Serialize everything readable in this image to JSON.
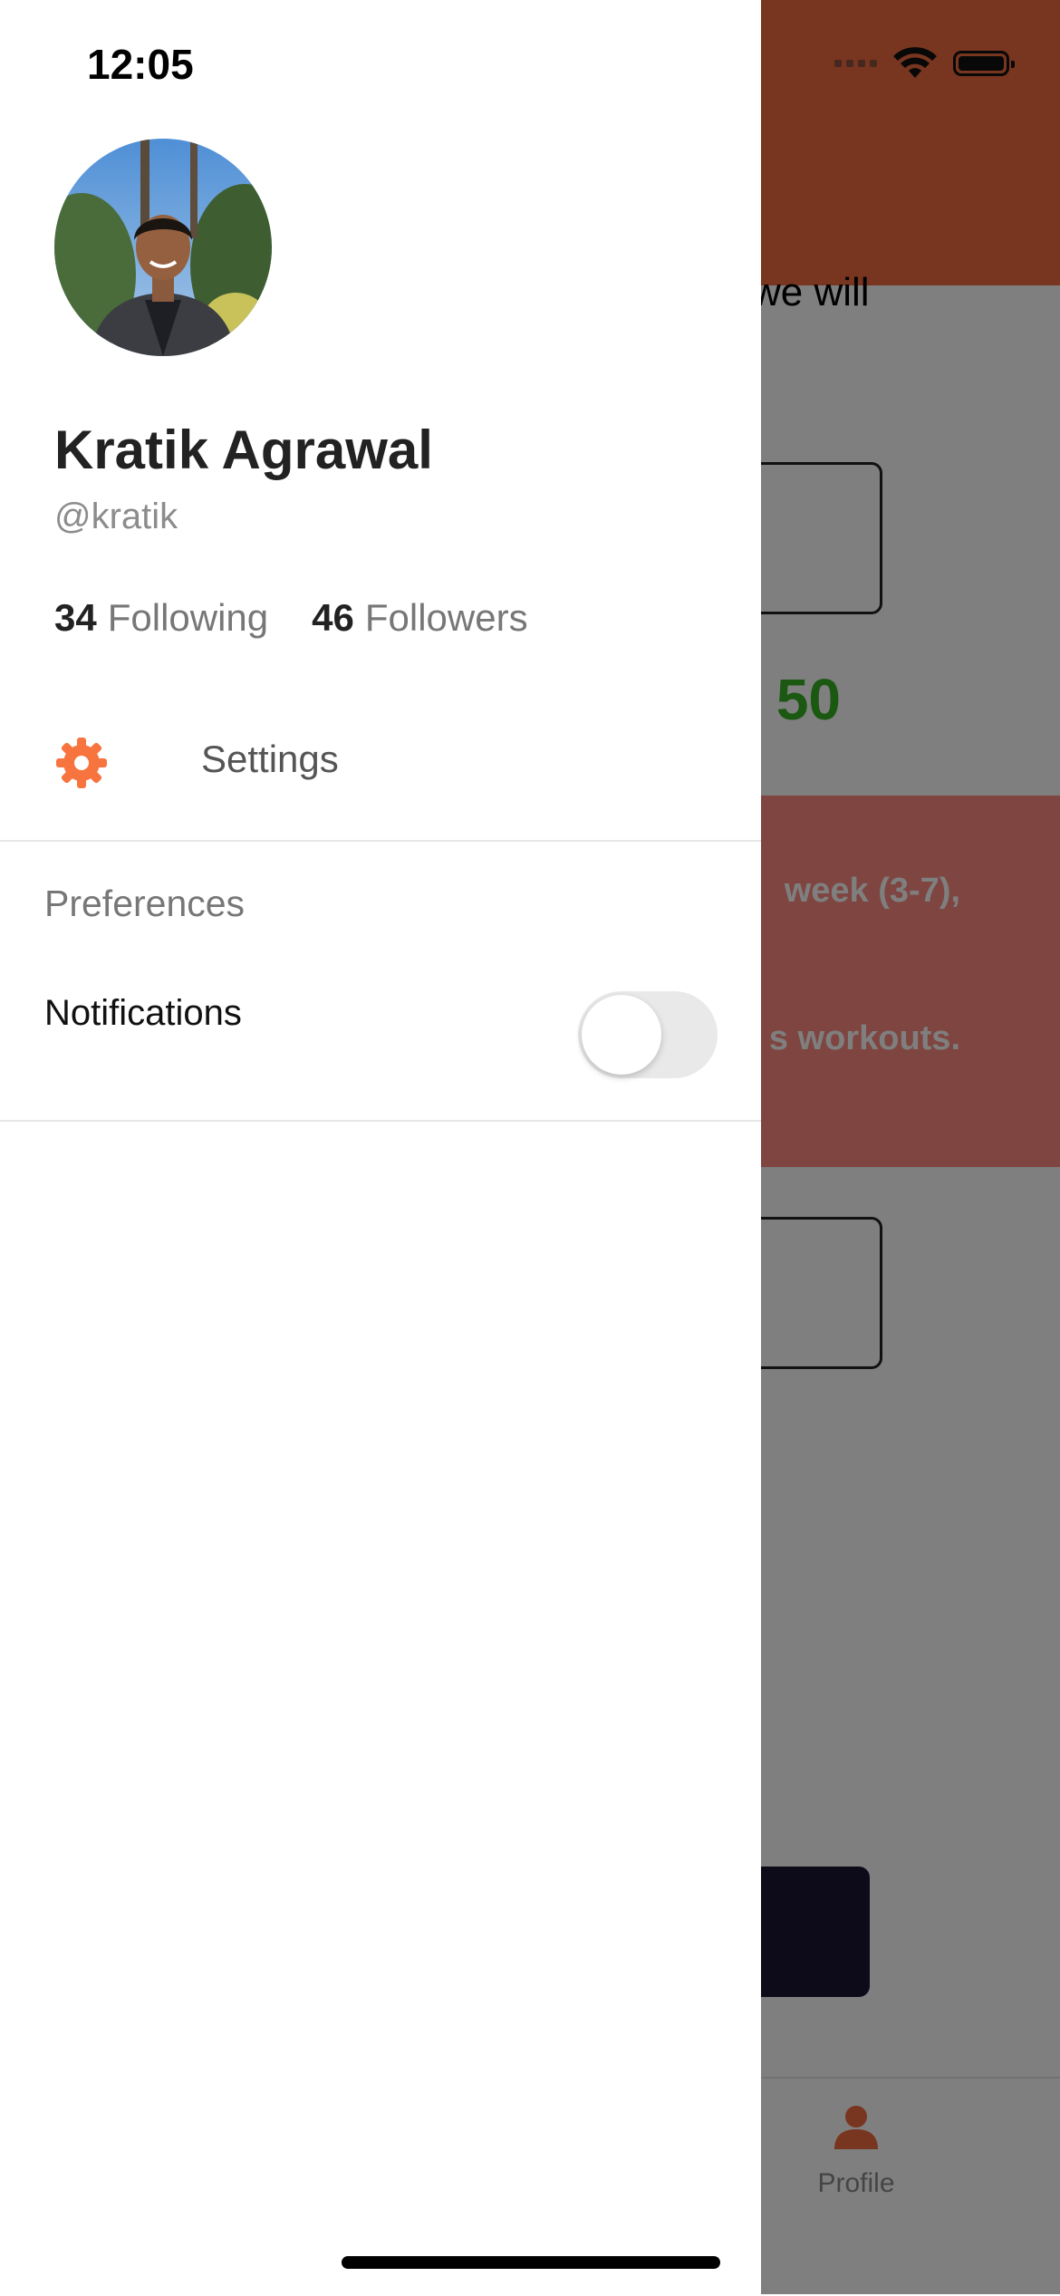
{
  "status_bar": {
    "time": "12:05"
  },
  "profile": {
    "name": "Kratik Agrawal",
    "handle": "@kratik",
    "avatar_icon": "profile-photo",
    "following_count": "34",
    "following_label": "Following",
    "followers_count": "46",
    "followers_label": "Followers"
  },
  "menu": {
    "settings_label": "Settings",
    "settings_icon": "gear-icon",
    "accent_color": "#f7743f"
  },
  "preferences": {
    "section_title": "Preferences",
    "notifications_label": "Notifications",
    "notifications_enabled": false
  },
  "background_app": {
    "intro_text": "we will",
    "amount_text": "50",
    "warning_line_1": "week (3-7),",
    "warning_line_2": "s workouts.",
    "tab_profile_label": "Profile",
    "header_color": "#f06a3e",
    "amount_color": "#37b024",
    "warning_color": "#ff8a80"
  }
}
